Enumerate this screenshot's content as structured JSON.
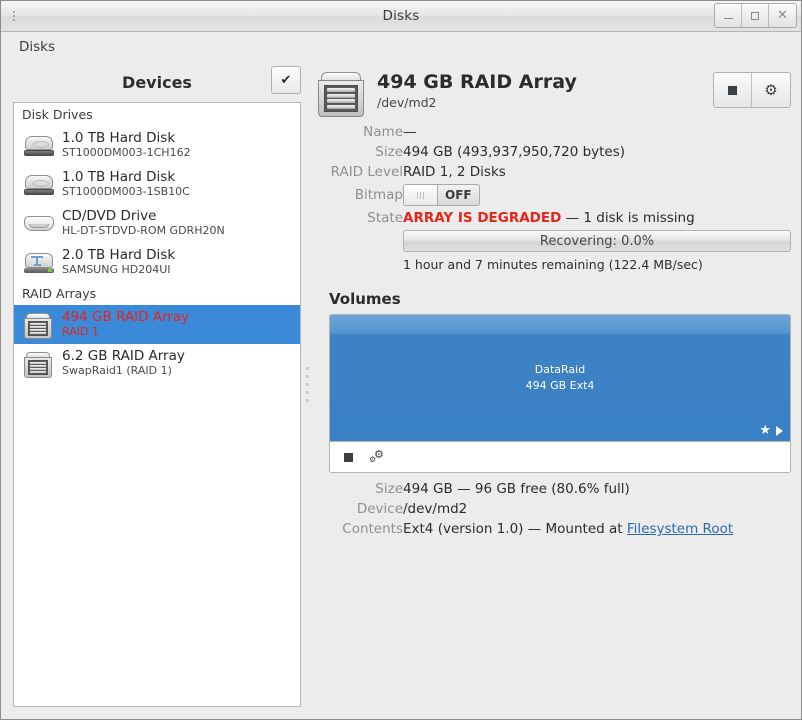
{
  "window": {
    "title": "Disks",
    "buttons": {
      "minimize": "_",
      "maximize": "□",
      "close": "✕"
    }
  },
  "menubar": {
    "app_menu": "Disks"
  },
  "sidebar": {
    "title": "Devices",
    "check_button_icon": "✔",
    "groups": [
      {
        "header": "Disk Drives",
        "items": [
          {
            "name": "1.0 TB Hard Disk",
            "sub": "ST1000DM003-1CH162",
            "icon": "hard-disk-icon",
            "selected": false
          },
          {
            "name": "1.0 TB Hard Disk",
            "sub": "ST1000DM003-1SB10C",
            "icon": "hard-disk-icon",
            "selected": false
          },
          {
            "name": "CD/DVD Drive",
            "sub": "HL-DT-STDVD-ROM GDRH20N",
            "icon": "cd-dvd-icon",
            "selected": false
          },
          {
            "name": "2.0 TB Hard Disk",
            "sub": "SAMSUNG HD204UI",
            "icon": "usb-disk-icon",
            "selected": false
          }
        ]
      },
      {
        "header": "RAID Arrays",
        "items": [
          {
            "name": "494 GB RAID Array",
            "sub": "RAID 1",
            "icon": "raid-array-icon",
            "selected": true
          },
          {
            "name": "6.2 GB RAID Array",
            "sub": "SwapRaid1 (RAID 1)",
            "icon": "raid-array-icon",
            "selected": false
          }
        ]
      }
    ]
  },
  "detail": {
    "title": "494 GB RAID Array",
    "device_path": "/dev/md2",
    "icon": "raid-array-icon",
    "actions": [
      {
        "name": "stop-array-button",
        "icon": "stop-square-icon"
      },
      {
        "name": "array-settings-button",
        "icon": "gear-icon"
      }
    ],
    "properties": [
      {
        "label": "Name",
        "value": "—"
      },
      {
        "label": "Size",
        "value": "494 GB (493,937,950,720 bytes)"
      },
      {
        "label": "RAID Level",
        "value": "RAID 1, 2 Disks"
      }
    ],
    "bitmap": {
      "label": "Bitmap",
      "state": "OFF",
      "on": false
    },
    "state": {
      "label": "State",
      "alert": "ARRAY IS DEGRADED",
      "detail": "— 1 disk is missing",
      "alert_color": "#e8231a"
    },
    "progress": {
      "text": "Recovering: 0.0%",
      "percent": 0.0,
      "note": "1 hour and 7 minutes remaining (122.4 MB/sec)"
    }
  },
  "volumes": {
    "section_title": "Volumes",
    "blocks": [
      {
        "name": "DataRaid",
        "sub": "494 GB Ext4",
        "badges": [
          "star-icon",
          "play-icon"
        ],
        "accent": "#3a80c4"
      }
    ],
    "toolbar": [
      {
        "name": "unmount-volume-button",
        "icon": "stop-square-icon"
      },
      {
        "name": "volume-options-button",
        "icon": "gears-icon"
      }
    ],
    "properties": [
      {
        "label": "Size",
        "value": "494 GB — 96 GB free (80.6% full)"
      },
      {
        "label": "Device",
        "value": "/dev/md2"
      }
    ],
    "contents": {
      "label": "Contents",
      "prefix": "Ext4 (version 1.0) — Mounted at ",
      "link": "Filesystem Root"
    }
  }
}
